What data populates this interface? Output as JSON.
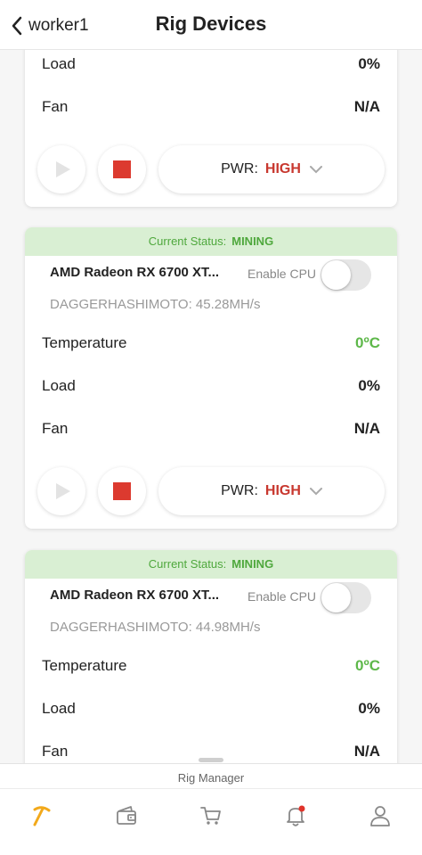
{
  "header": {
    "back_label": "worker1",
    "title": "Rig Devices"
  },
  "card0": {
    "metrics": [
      {
        "label": "Load",
        "value": "0%"
      },
      {
        "label": "Fan",
        "value": "N/A"
      }
    ],
    "pwr_label": "PWR:",
    "pwr_value": "HIGH"
  },
  "cards": [
    {
      "status_label": "Current Status:",
      "status_value": "MINING",
      "gpu_name": "AMD Radeon RX 6700 XT...",
      "enable_cpu_label": "Enable CPU",
      "enable_cpu": false,
      "algo": "DAGGERHASHIMOTO: 45.28MH/s",
      "metrics": [
        {
          "label": "Temperature",
          "value": "0ºC"
        },
        {
          "label": "Load",
          "value": "0%"
        },
        {
          "label": "Fan",
          "value": "N/A"
        }
      ],
      "pwr_label": "PWR:",
      "pwr_value": "HIGH"
    },
    {
      "status_label": "Current Status:",
      "status_value": "MINING",
      "gpu_name": "AMD Radeon RX 6700 XT...",
      "enable_cpu_label": "Enable CPU",
      "enable_cpu": false,
      "algo": "DAGGERHASHIMOTO: 44.98MH/s",
      "metrics": [
        {
          "label": "Temperature",
          "value": "0ºC"
        },
        {
          "label": "Load",
          "value": "0%"
        },
        {
          "label": "Fan",
          "value": "N/A"
        }
      ]
    }
  ],
  "bottom_bar": {
    "title": "Rig Manager",
    "tabs": [
      {
        "icon": "pickaxe-icon",
        "active": true
      },
      {
        "icon": "wallet-icon",
        "active": false
      },
      {
        "icon": "cart-icon",
        "active": false
      },
      {
        "icon": "bell-icon",
        "active": false,
        "badge": true
      },
      {
        "icon": "user-icon",
        "active": false
      }
    ]
  },
  "colors": {
    "status_bg": "#d9efd3",
    "status_text": "#4fa83d",
    "temp_green": "#5eb84a",
    "pwr_red": "#c8382f",
    "stop_red": "#dc3a2f",
    "active_tab": "#f2a91b",
    "notification_dot": "#e0332a"
  }
}
